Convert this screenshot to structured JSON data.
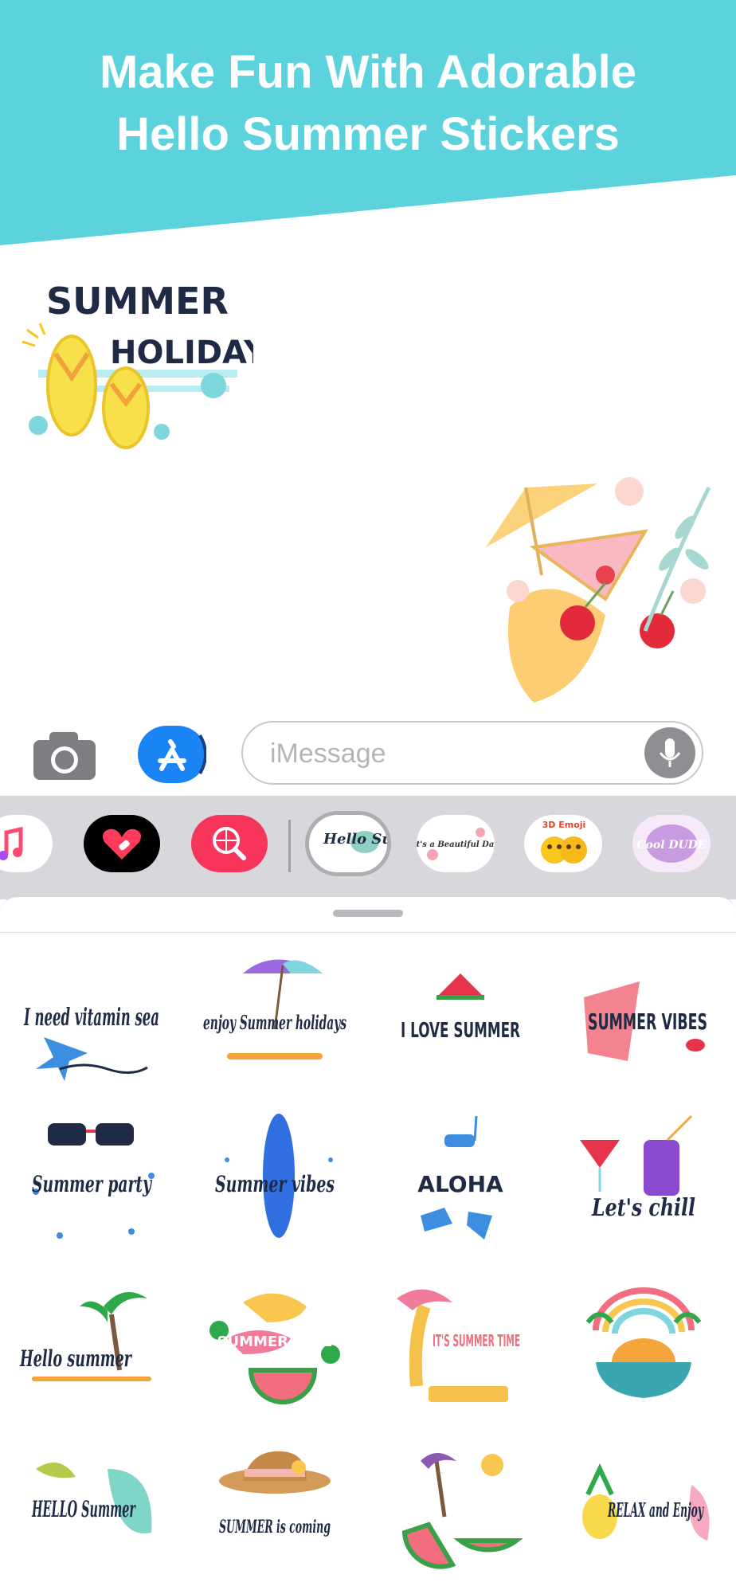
{
  "banner": {
    "line1": "Make Fun With Adorable",
    "line2": "Hello Summer Stickers",
    "color": "#5cd3dc"
  },
  "chat": {
    "holiday_sticker": {
      "word1": "SUMMER",
      "word2": "HOLIDAY"
    }
  },
  "input_bar": {
    "placeholder": "iMessage",
    "camera_icon": "camera-icon",
    "appstore_icon": "app-store-icon",
    "mic_icon": "microphone-icon",
    "appstore_color": "#1a84f5"
  },
  "drawer": {
    "apps": [
      {
        "name": "music-app-icon"
      },
      {
        "name": "heart-app-icon"
      },
      {
        "name": "search-globe-app-icon"
      },
      {
        "name": "hello-summer-app-icon",
        "label": "Hello Summer",
        "selected": true
      },
      {
        "name": "beautiful-day-app-icon",
        "label": "It's a Beautiful Day"
      },
      {
        "name": "3d-emoji-app-icon",
        "label": "3D Emoji"
      },
      {
        "name": "cool-dude-app-icon",
        "label": "Cool DUDE"
      }
    ]
  },
  "stickers": [
    {
      "text": "I need vitamin sea"
    },
    {
      "text": "enjoy Summer holidays"
    },
    {
      "text": "I LOVE SUMMER"
    },
    {
      "text": "SUMMER VIBES"
    },
    {
      "text": "Summer party"
    },
    {
      "text": "Summer vibes"
    },
    {
      "text": "ALOHA"
    },
    {
      "text": "Let's chill"
    },
    {
      "text": "Hello summer"
    },
    {
      "text": "SUMMER TIME"
    },
    {
      "text": "IT'S SUMMER TIME"
    },
    {
      "text": ""
    },
    {
      "text": "HELLO Summer"
    },
    {
      "text": "SUMMER is coming"
    },
    {
      "text": ""
    },
    {
      "text": "RELAX and Enjoy"
    }
  ]
}
